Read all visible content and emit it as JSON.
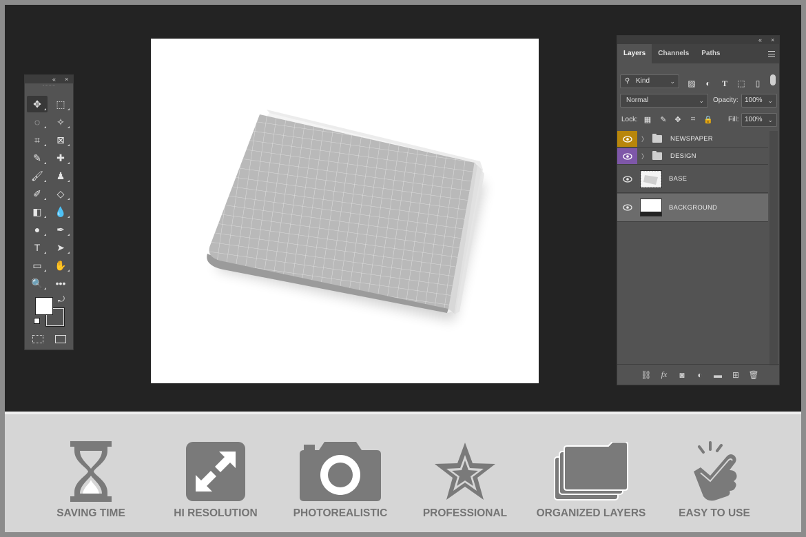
{
  "toolbox": {
    "collapse_glyph": "«",
    "close_glyph": "×",
    "tools": [
      {
        "name": "move-tool-icon",
        "glyph": "✥"
      },
      {
        "name": "marquee-tool-icon",
        "glyph": "⬚"
      },
      {
        "name": "lasso-tool-icon",
        "glyph": "◌"
      },
      {
        "name": "magic-wand-tool-icon",
        "glyph": "✧"
      },
      {
        "name": "crop-tool-icon",
        "glyph": "⌗"
      },
      {
        "name": "frame-tool-icon",
        "glyph": "⊠"
      },
      {
        "name": "eyedropper-tool-icon",
        "glyph": "✎"
      },
      {
        "name": "healing-brush-tool-icon",
        "glyph": "✚"
      },
      {
        "name": "brush-tool-icon",
        "glyph": "🖌"
      },
      {
        "name": "clone-stamp-tool-icon",
        "glyph": "♟"
      },
      {
        "name": "history-brush-tool-icon",
        "glyph": "✐"
      },
      {
        "name": "eraser-tool-icon",
        "glyph": "◇"
      },
      {
        "name": "gradient-tool-icon",
        "glyph": "◧"
      },
      {
        "name": "blur-tool-icon",
        "glyph": "💧"
      },
      {
        "name": "dodge-tool-icon",
        "glyph": "●"
      },
      {
        "name": "pen-tool-icon",
        "glyph": "✒"
      },
      {
        "name": "type-tool-icon",
        "glyph": "T"
      },
      {
        "name": "path-selection-tool-icon",
        "glyph": "➤"
      },
      {
        "name": "rectangle-tool-icon",
        "glyph": "▭"
      },
      {
        "name": "hand-tool-icon",
        "glyph": "✋"
      },
      {
        "name": "zoom-tool-icon",
        "glyph": "🔍"
      },
      {
        "name": "more-tools-icon",
        "glyph": "•••"
      }
    ]
  },
  "layers_panel": {
    "tabs": [
      "Layers",
      "Channels",
      "Paths"
    ],
    "filter_kind": "Kind",
    "blend_mode": "Normal",
    "opacity_label": "Opacity:",
    "opacity_value": "100%",
    "lock_label": "Lock:",
    "fill_label": "Fill:",
    "fill_value": "100%",
    "layers": [
      {
        "name": "NEWSPAPER",
        "type": "group",
        "eye_color": "#b8860b",
        "selected": false
      },
      {
        "name": "DESIGN",
        "type": "group",
        "eye_color": "#7e57a8",
        "selected": false
      },
      {
        "name": "BASE",
        "type": "layer",
        "eye_color": "",
        "selected": false
      },
      {
        "name": "BACKGROUND",
        "type": "layer",
        "eye_color": "",
        "selected": true
      }
    ],
    "footer_icons": [
      "link-layers-icon",
      "fx-icon",
      "mask-icon",
      "adjustment-icon",
      "new-group-icon",
      "new-layer-icon",
      "trash-icon"
    ],
    "footer_glyphs": [
      "⛓",
      "fx",
      "◙",
      "◐",
      "▬",
      "⊞",
      "🗑"
    ]
  },
  "features": [
    {
      "label": "SAVING TIME",
      "icon": "hourglass-icon"
    },
    {
      "label": "HI RESOLUTION",
      "icon": "expand-arrows-icon"
    },
    {
      "label": "PHOTOREALISTIC",
      "icon": "camera-icon"
    },
    {
      "label": "PROFESSIONAL",
      "icon": "star-icon"
    },
    {
      "label": "ORGANIZED LAYERS",
      "icon": "layers-folders-icon"
    },
    {
      "label": "EASY TO USE",
      "icon": "pointing-hand-icon"
    }
  ],
  "colors": {
    "workspace": "#232323",
    "panel": "#535353",
    "feature_icon": "#7a7a7a",
    "feature_text": "#747474"
  }
}
